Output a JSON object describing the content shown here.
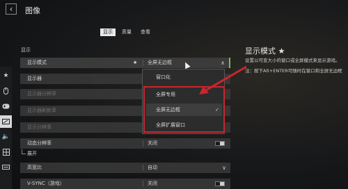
{
  "header": {
    "back_icon": "chevron-left",
    "title": "图像"
  },
  "tabs": [
    {
      "label": "显示",
      "active": true
    },
    {
      "label": "质量",
      "active": false
    },
    {
      "label": "查看",
      "active": false
    }
  ],
  "rail": [
    "star-icon",
    "mouse-icon",
    "gamepad-icon",
    "display-icon",
    "speaker-icon",
    "grid-icon",
    "keyboard-icon"
  ],
  "section_label": "显示",
  "rows": {
    "display_mode": {
      "label": "显示模式",
      "star": "★",
      "value": "全屏无边框",
      "chevron": "∧"
    },
    "display": {
      "label": "显示器"
    },
    "monitor_resolution": {
      "label": "显示器分辨率"
    },
    "refresh_rate": {
      "label": "显示器刷新率"
    },
    "render_resolution": {
      "label": "显示分辨率"
    },
    "dynamic_resolution": {
      "label": "动态分辨率",
      "value": "关闭"
    },
    "expand": {
      "label": "展开"
    },
    "aspect_ratio": {
      "label": "高宽比",
      "value": "自动",
      "chevron": "∨"
    },
    "vsync": {
      "label": "V-SYNC（游戏）",
      "value": "关闭"
    }
  },
  "dropdown": {
    "options": [
      {
        "label": "窗口化",
        "selected": false
      },
      {
        "label": "全屏专用",
        "selected": false
      },
      {
        "label": "全屏无边框",
        "selected": true
      },
      {
        "label": "全屏扩展窗口",
        "selected": false
      }
    ],
    "check_glyph": "✓"
  },
  "info": {
    "title": "显示模式 ★",
    "description": "设置以可变大小的窗口或全屏模式来显示游戏。",
    "note": "注：按下Alt+ENTER可随时在窗口和全屏无边框"
  },
  "colors": {
    "highlight_border": "#7dbd4a",
    "annotation_red": "#c9262d"
  }
}
